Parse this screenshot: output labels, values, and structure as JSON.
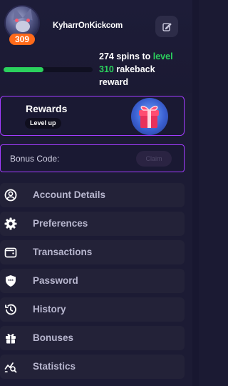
{
  "profile": {
    "username": "KyharrOnKickcom",
    "level": "309",
    "progress_fraction": 0.45,
    "spins_prefix": "274 spins to ",
    "spins_level": "level",
    "spins_level_number": "310",
    "spins_suffix": " rakeback",
    "spins_line3": "reward"
  },
  "rewards": {
    "title": "Rewards",
    "badge": "Level up"
  },
  "bonus": {
    "label": "Bonus Code:",
    "value": "",
    "placeholder": "",
    "claim_label": "Claim"
  },
  "menu": {
    "items": [
      {
        "label": "Account Details",
        "icon": "user-circle-icon"
      },
      {
        "label": "Preferences",
        "icon": "gear-icon"
      },
      {
        "label": "Transactions",
        "icon": "wallet-icon"
      },
      {
        "label": "Password",
        "icon": "shield-icon"
      },
      {
        "label": "History",
        "icon": "history-icon"
      },
      {
        "label": "Bonuses",
        "icon": "gift-icon"
      },
      {
        "label": "Statistics",
        "icon": "statistics-icon"
      }
    ]
  },
  "colors": {
    "accent_purple": "#a23cff",
    "progress_green": "#2bd15d",
    "level_orange": "#ff6a1a",
    "background": "#1b1a33"
  }
}
